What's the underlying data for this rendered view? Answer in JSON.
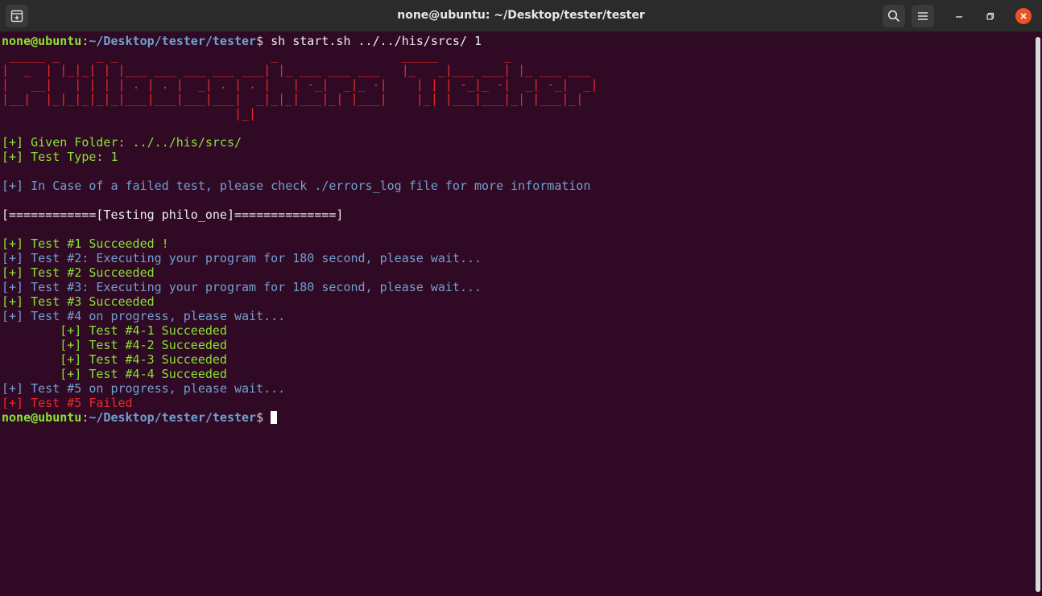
{
  "window": {
    "title": "none@ubuntu: ~/Desktop/tester/tester"
  },
  "icons": {
    "new_tab": "new-tab-icon",
    "search": "search-icon",
    "menu": "hamburger-menu-icon",
    "minimize": "minimize-icon",
    "maximize": "maximize-icon",
    "close": "close-icon"
  },
  "colors": {
    "background": "#300a24",
    "titlebar": "#2b2b2b",
    "prompt_user": "#8ae234",
    "prompt_path": "#729fcf",
    "success": "#8ae234",
    "info": "#729fcf",
    "failure": "#ef2929",
    "close_button": "#e95420"
  },
  "terminal": {
    "prompt": {
      "user_host": "none@ubuntu",
      "separator": ":",
      "path": "~/Desktop/tester/tester",
      "symbol": "$"
    },
    "command": " sh start.sh ../../his/srcs/ 1",
    "banner": [
      " _____ _     _ _                     _                 _____         _            ",
      "|  _  | |_|_| | |___ ___ ___ ___ ___| |_ ___ ___ ___   |_   _|___ ___| |_ ___ ___ ",
      "|   __|   | | | | . | . |  _| . | . |   | -_|  _|_ -|    | | | -_|_ -|  _| -_|  _|",
      "|__|  |_|_|_|_|_|___|___|___|___|  _|_|_|___|_| |___|    |_| |___|___|_| |___|_|  ",
      "                                |_|                                               "
    ],
    "given_folder": "[+] Given Folder: ../../his/srcs/",
    "test_type": "[+] Test Type: 1",
    "info_line": "[+] In Case of a failed test, please check ./errors_log file for more information",
    "section_header": "[============[Testing philo_one]==============]",
    "results": {
      "t1_success": "[+] Test #1 Succeeded !",
      "t2_exec": "[+] Test #2: Executing your program for 180 second, please wait...",
      "t2_success": "[+] Test #2 Succeeded",
      "t3_exec": "[+] Test #3: Executing your program for 180 second, please wait...",
      "t3_success": "[+] Test #3 Succeeded",
      "t4_progress": "[+] Test #4 on progress, please wait...",
      "t4_1": "        [+] Test #4-1 Succeeded",
      "t4_2": "        [+] Test #4-2 Succeeded",
      "t4_3": "        [+] Test #4-3 Succeeded",
      "t4_4": "        [+] Test #4-4 Succeeded",
      "t5_progress": "[+] Test #5 on progress, please wait...",
      "t5_failed": "[+] Test #5 Failed"
    }
  }
}
